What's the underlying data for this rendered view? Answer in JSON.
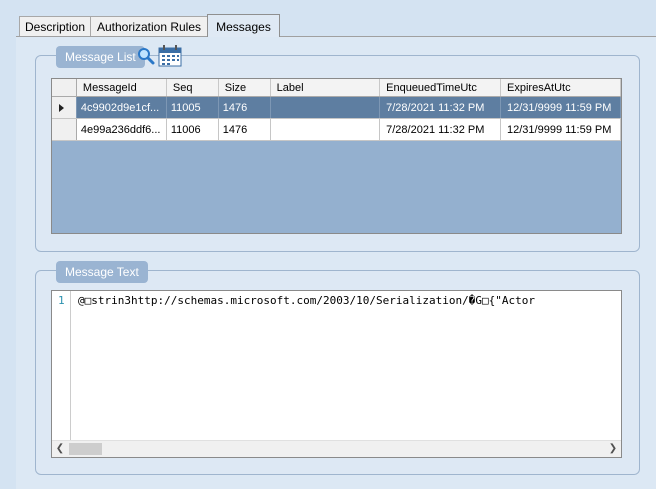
{
  "tabs": [
    {
      "label": "Description",
      "active": false
    },
    {
      "label": "Authorization Rules",
      "active": false
    },
    {
      "label": "Messages",
      "active": true
    }
  ],
  "message_list": {
    "title": "Message List",
    "columns": [
      "MessageId",
      "Seq",
      "Size",
      "Label",
      "EnqueuedTimeUtc",
      "ExpiresAtUtc"
    ],
    "rows": [
      {
        "message_id": "4c9902d9e1cf...",
        "seq": "11005",
        "size": "1476",
        "label": "",
        "enqueued": "7/28/2021 11:32 PM",
        "expires": "12/31/9999 11:59 PM",
        "selected": true
      },
      {
        "message_id": "4e99a236ddf6...",
        "seq": "11006",
        "size": "1476",
        "label": "",
        "enqueued": "7/28/2021 11:32 PM",
        "expires": "12/31/9999 11:59 PM",
        "selected": false
      }
    ],
    "icons": [
      "search-icon",
      "calendar-icon"
    ]
  },
  "message_text": {
    "title": "Message Text",
    "line_number": "1",
    "content": "@□strin3http://schemas.microsoft.com/2003/10/Serialization/�G□{\"Actor"
  },
  "colors": {
    "accent": "#9ab4d2",
    "selected_row": "#5e7ea1",
    "background": "#d4e3f2"
  }
}
